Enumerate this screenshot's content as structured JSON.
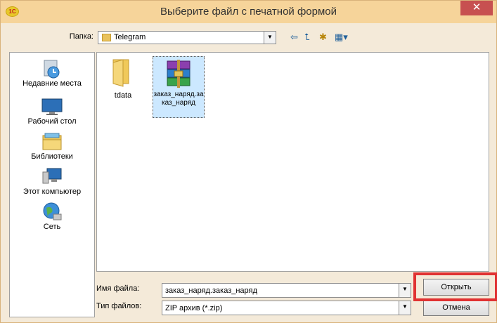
{
  "window": {
    "title": "Выберите файл с печатной формой",
    "close": "✕",
    "app_icon_text": "1С"
  },
  "toolbar": {
    "folder_label": "Папка:",
    "folder_value": "Telegram"
  },
  "places": [
    {
      "label": "Недавние места"
    },
    {
      "label": "Рабочий стол"
    },
    {
      "label": "Библиотеки"
    },
    {
      "label": "Этот компьютер"
    },
    {
      "label": "Сеть"
    }
  ],
  "files": [
    {
      "name": "tdata",
      "type": "folder"
    },
    {
      "name": "заказ_наряд.заказ_наряд",
      "type": "zip-archive",
      "selected": true
    }
  ],
  "form": {
    "filename_label": "Имя файла:",
    "filename_value": "заказ_наряд.заказ_наряд",
    "filetype_label": "Тип файлов:",
    "filetype_value": "ZIP архив (*.zip)",
    "open_label": "Открыть",
    "cancel_label": "Отмена"
  },
  "colors": {
    "title_bar": "#f6d49a",
    "close": "#c75050",
    "highlight": "#e03232",
    "selection": "#cce8ff"
  }
}
